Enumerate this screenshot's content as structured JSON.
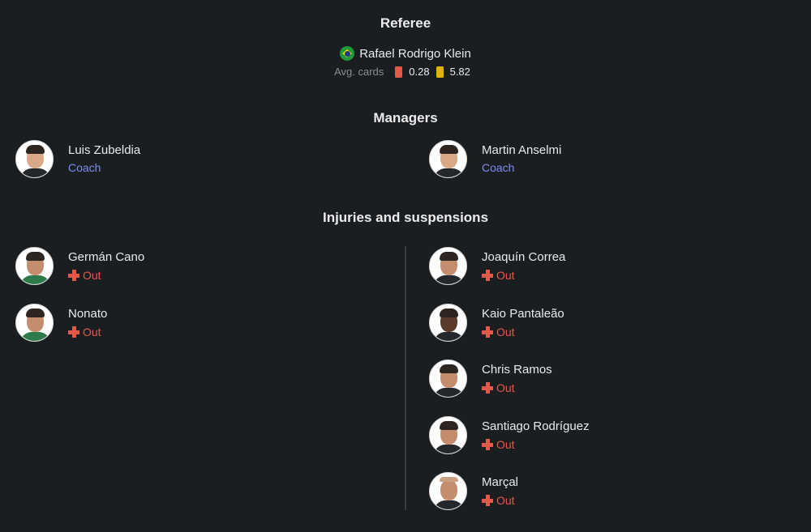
{
  "referee": {
    "title": "Referee",
    "name": "Rafael Rodrigo Klein",
    "flag_icon": "brazil-flag",
    "avg_label": "Avg. cards",
    "red_avg": "0.28",
    "yellow_avg": "5.82",
    "red_color": "#e4584a",
    "yellow_color": "#e0b500"
  },
  "managers": {
    "title": "Managers",
    "home": {
      "name": "Luis Zubeldia",
      "role": "Coach"
    },
    "away": {
      "name": "Martin Anselmi",
      "role": "Coach"
    }
  },
  "injuries": {
    "title": "Injuries and suspensions",
    "home": [
      {
        "name": "Germán Cano",
        "status": "Out"
      },
      {
        "name": "Nonato",
        "status": "Out"
      }
    ],
    "away": [
      {
        "name": "Joaquín Correa",
        "status": "Out"
      },
      {
        "name": "Kaio Pantaleão",
        "status": "Out"
      },
      {
        "name": "Chris Ramos",
        "status": "Out"
      },
      {
        "name": "Santiago Rodríguez",
        "status": "Out"
      },
      {
        "name": "Marçal",
        "status": "Out"
      }
    ]
  }
}
